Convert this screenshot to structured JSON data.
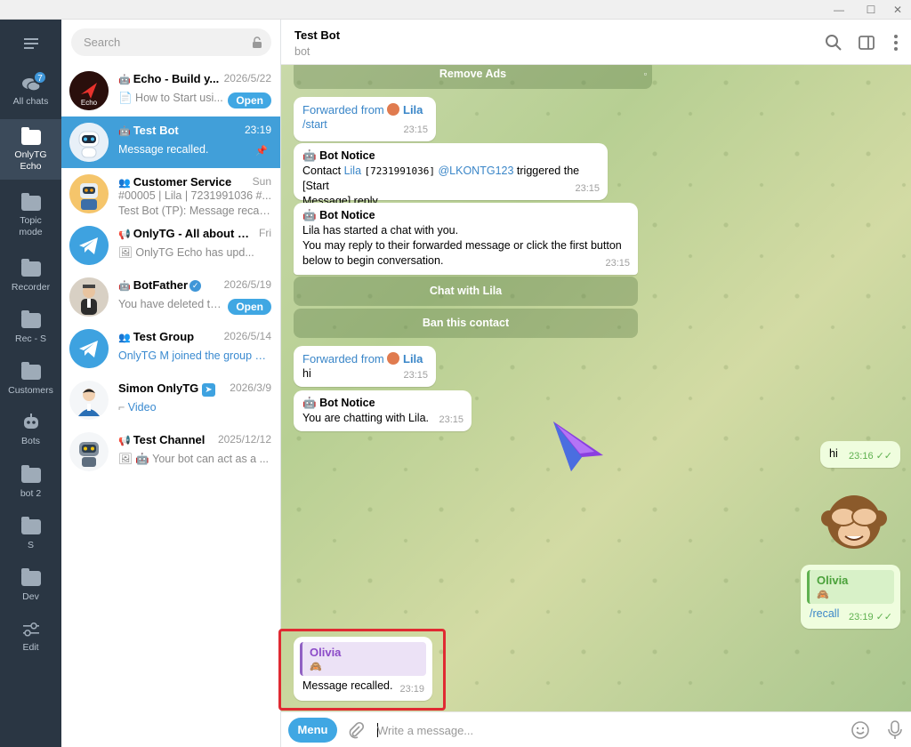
{
  "window": {
    "minimize": "—",
    "maximize": "☐",
    "close": "✕"
  },
  "folders": [
    {
      "label": "All chats",
      "badge": "7",
      "icon": "chats-icon"
    },
    {
      "label": "OnlyTG Echo",
      "icon": "folder-icon",
      "active": true
    },
    {
      "label": "Topic mode",
      "icon": "folder-icon"
    },
    {
      "label": "Recorder",
      "icon": "folder-icon"
    },
    {
      "label": "Rec - S",
      "icon": "folder-icon"
    },
    {
      "label": "Customers",
      "icon": "folder-icon"
    },
    {
      "label": "Bots",
      "icon": "bot-icon"
    },
    {
      "label": "bot 2",
      "icon": "folder-icon"
    },
    {
      "label": "S",
      "icon": "folder-icon"
    },
    {
      "label": "Dev",
      "icon": "folder-icon"
    },
    {
      "label": "Edit",
      "icon": "sliders-icon"
    }
  ],
  "search": {
    "placeholder": "Search"
  },
  "chats": [
    {
      "name": "Echo - Build y...",
      "date": "2026/5/22",
      "preview": "How to Start usi...",
      "pill": "Open",
      "type": "bot"
    },
    {
      "name": "Test Bot",
      "date": "23:19",
      "preview": "Message recalled.",
      "type": "bot",
      "active": true
    },
    {
      "name": "Customer Service",
      "date": "Sun",
      "line2": "#00005 | Lila | 7231991036 #...",
      "preview": "Test Bot (TP): Message recalle...",
      "type": "group"
    },
    {
      "name": "OnlyTG - All about Tel...",
      "date": "Fri",
      "preview": "OnlyTG Echo has upd...",
      "type": "channel"
    },
    {
      "name": "BotFather",
      "date": "2026/5/19",
      "preview": "You have deleted tes...",
      "pill": "Open",
      "type": "bot"
    },
    {
      "name": "Test Group",
      "date": "2026/5/14",
      "preview": "OnlyTG M joined the group vi...",
      "type": "group"
    },
    {
      "name": "Simon OnlyTG",
      "date": "2026/3/9",
      "preview": "Video",
      "type": "user"
    },
    {
      "name": "Test Channel",
      "date": "2025/12/12",
      "preview": "Your bot can act as a ...",
      "type": "channel"
    }
  ],
  "header": {
    "title": "Test Bot",
    "subtitle": "bot"
  },
  "messages": {
    "remove_ads": "Remove Ads",
    "fwd1": {
      "label": "Forwarded from",
      "name": "Lila",
      "text": "/start",
      "time": "23:15"
    },
    "notice1": {
      "title": "Bot Notice",
      "pre": "Contact ",
      "link_name": "Lila",
      "id": "[7231991036]",
      "handle": "@LKONTG123",
      "post": " triggered the [Start",
      "line2": "Message] reply",
      "time": "23:15"
    },
    "notice2": {
      "title": "Bot Notice",
      "line1": "Lila has started a chat with you.",
      "line2": "You may reply to their forwarded message or click the first button",
      "line3": "below to begin conversation.",
      "time": "23:15"
    },
    "btn_chat": "Chat with Lila",
    "btn_ban": "Ban this contact",
    "fwd2": {
      "label": "Forwarded from",
      "name": "Lila",
      "text": "hi",
      "time": "23:15"
    },
    "notice3": {
      "title": "Bot Notice",
      "text": "You are chatting with Lila.",
      "time": "23:15"
    },
    "out_hi": {
      "text": "hi",
      "time": "23:16"
    },
    "out_recall": {
      "reply_name": "Olivia",
      "text": "/recall",
      "time": "23:19"
    },
    "in_recalled": {
      "reply_name": "Olivia",
      "text": "Message recalled.",
      "time": "23:19"
    }
  },
  "composer": {
    "menu": "Menu",
    "placeholder": "Write a message..."
  },
  "colors": {
    "accent": "#40a7e3",
    "sidebar": "#2a3643",
    "highlight": "#e02a32"
  }
}
